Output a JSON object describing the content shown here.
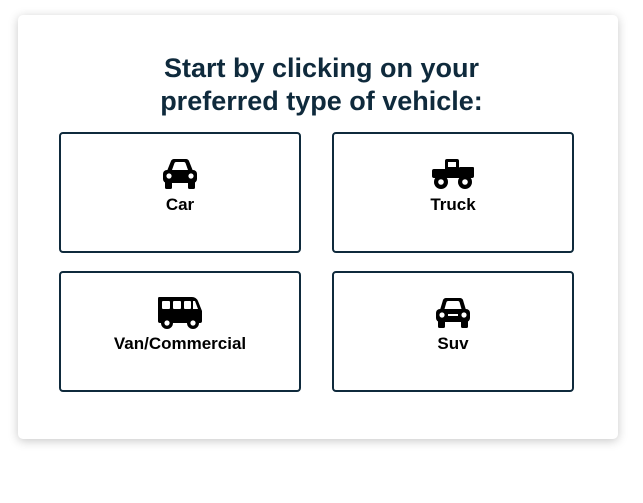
{
  "heading": {
    "line1": "Start by clicking on your",
    "line2": "preferred type of vehicle:"
  },
  "options": [
    {
      "label": "Car",
      "icon": "car-icon"
    },
    {
      "label": "Truck",
      "icon": "truck-icon"
    },
    {
      "label": "Van/Commercial",
      "icon": "van-icon"
    },
    {
      "label": "Suv",
      "icon": "suv-icon"
    }
  ],
  "colors": {
    "heading": "#0f2a3c",
    "border": "#0f2a3c",
    "icon": "#000000",
    "label": "#000000"
  }
}
